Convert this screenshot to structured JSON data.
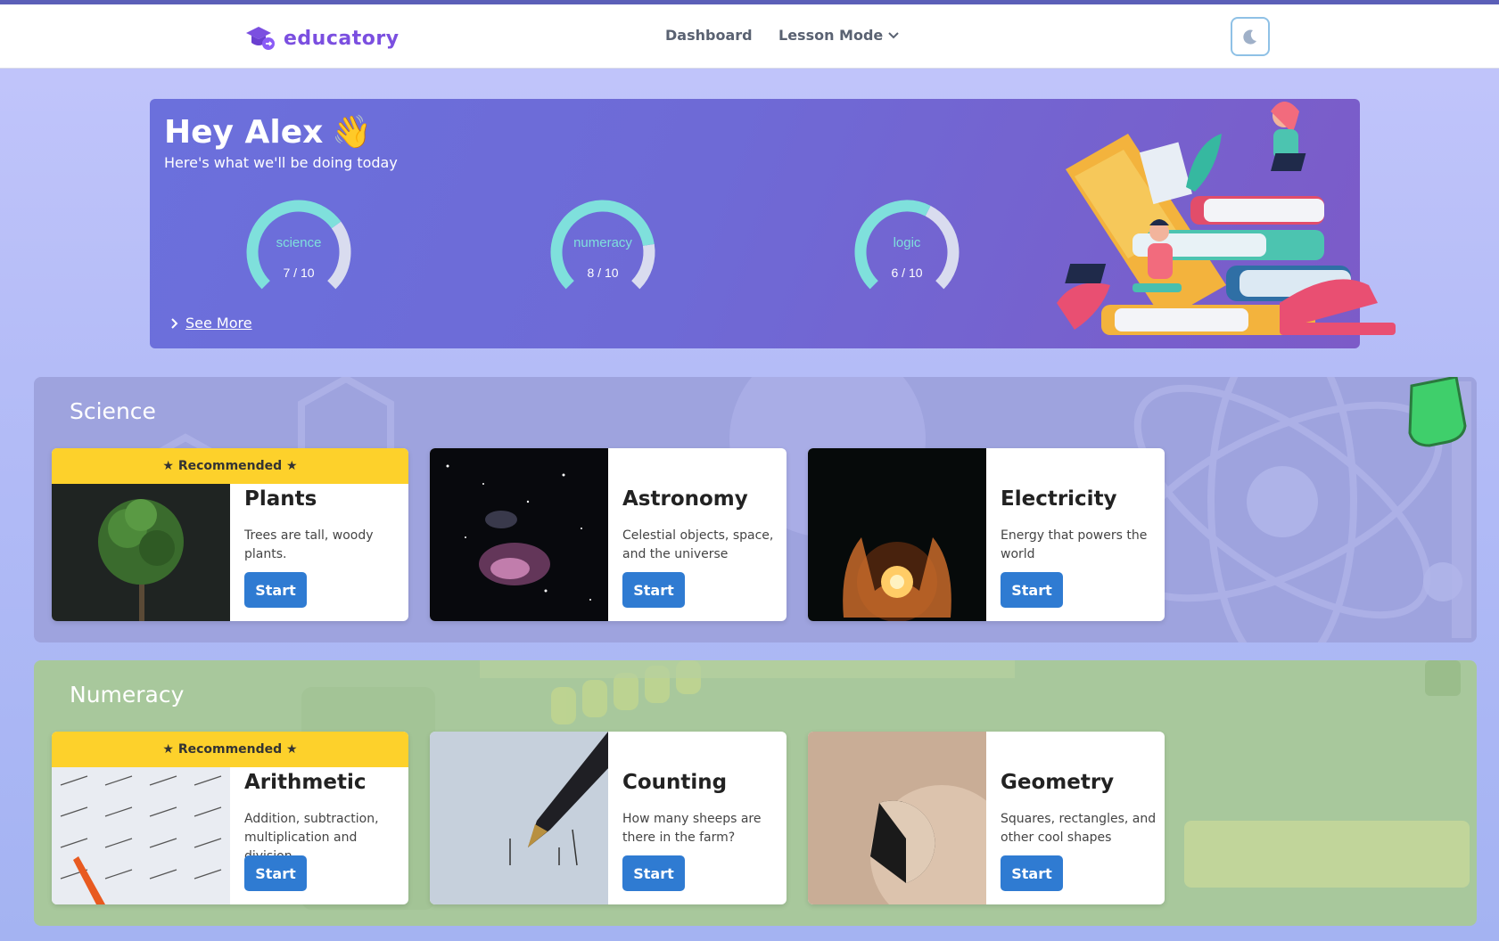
{
  "app": {
    "name": "educatory"
  },
  "nav": {
    "dashboard": "Dashboard",
    "lesson_mode": "Lesson Mode"
  },
  "hero": {
    "greeting": "Hey Alex",
    "emoji": "👋",
    "subtitle": "Here's what we'll be doing today",
    "see_more": "See More",
    "gauges": [
      {
        "label": "science",
        "value": "7 / 10",
        "fraction": 0.7
      },
      {
        "label": "numeracy",
        "value": "8 / 10",
        "fraction": 0.8
      },
      {
        "label": "logic",
        "value": "6 / 10",
        "fraction": 0.6
      }
    ]
  },
  "sections": [
    {
      "title": "Science",
      "cards": [
        {
          "recommended": "★ Recommended ★",
          "title": "Plants",
          "desc": "Trees are tall, woody plants.",
          "button": "Start"
        },
        {
          "title": "Astronomy",
          "desc": "Celestial objects, space, and the universe",
          "button": "Start"
        },
        {
          "title": "Electricity",
          "desc": "Energy that powers the world",
          "button": "Start"
        }
      ]
    },
    {
      "title": "Numeracy",
      "cards": [
        {
          "recommended": "★ Recommended ★",
          "title": "Arithmetic",
          "desc": "Addition, subtraction, multiplication and division",
          "button": "Start"
        },
        {
          "title": "Counting",
          "desc": "How many sheeps are there in the farm?",
          "button": "Start"
        },
        {
          "title": "Geometry",
          "desc": "Squares, rectangles, and other cool shapes",
          "button": "Start"
        }
      ]
    }
  ],
  "colors": {
    "accent": "#2f7bd2",
    "brand": "#7b4fe0",
    "recommended": "#fdd12b",
    "gauge": "#7fe0dc"
  }
}
